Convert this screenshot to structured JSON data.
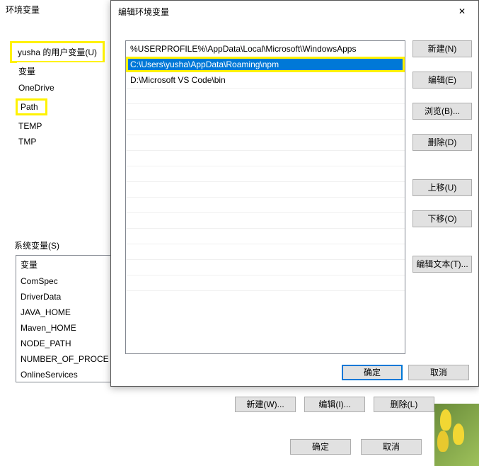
{
  "parent": {
    "title": "环境变量",
    "user_vars_label": "yusha 的用户变量(U)",
    "user_header": "变量",
    "user_items": [
      "OneDrive",
      "Path",
      "TEMP",
      "TMP"
    ],
    "sys_vars_label": "系统变量(S)",
    "sys_header": "变量",
    "sys_items": [
      "ComSpec",
      "DriverData",
      "JAVA_HOME",
      "Maven_HOME",
      "NODE_PATH",
      "NUMBER_OF_PROCE",
      "OnlineServices"
    ],
    "btn_new": "新建(W)...",
    "btn_edit": "编辑(I)...",
    "btn_delete": "删除(L)",
    "btn_ok": "确定",
    "btn_cancel": "取消"
  },
  "child": {
    "title": "编辑环境变量",
    "entries": [
      "%USERPROFILE%\\AppData\\Local\\Microsoft\\WindowsApps",
      "C:\\Users\\yusha\\AppData\\Roaming\\npm",
      "D:\\Microsoft VS Code\\bin"
    ],
    "selected_index": 1,
    "btn_new": "新建(N)",
    "btn_edit": "编辑(E)",
    "btn_browse": "浏览(B)...",
    "btn_delete": "删除(D)",
    "btn_moveup": "上移(U)",
    "btn_movedown": "下移(O)",
    "btn_edittext": "编辑文本(T)...",
    "btn_ok": "确定",
    "btn_cancel": "取消"
  }
}
